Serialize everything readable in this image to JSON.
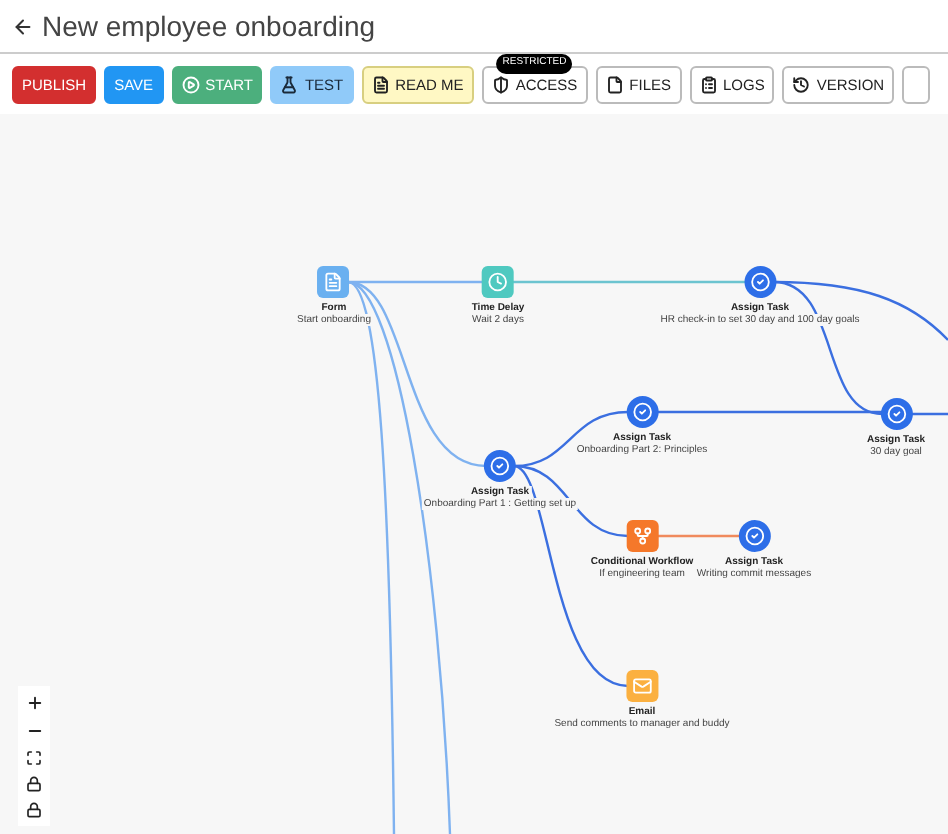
{
  "header": {
    "title": "New employee onboarding"
  },
  "toolbar": [
    {
      "kind": "publish",
      "label": "PUBLISH"
    },
    {
      "kind": "save",
      "label": "SAVE"
    },
    {
      "kind": "start",
      "label": "START"
    },
    {
      "kind": "test",
      "label": "TEST"
    },
    {
      "kind": "readme",
      "label": "READ ME"
    },
    {
      "kind": "access",
      "label": "ACCESS",
      "badge": "RESTRICTED"
    },
    {
      "kind": "files",
      "label": "FILES"
    },
    {
      "kind": "logs",
      "label": "LOGS"
    },
    {
      "kind": "version",
      "label": "VERSION"
    }
  ],
  "nodes": [
    {
      "kind": "form",
      "title": "Form",
      "subtitle": "Start onboarding"
    },
    {
      "kind": "delay",
      "title": "Time Delay",
      "subtitle": "Wait 2 days"
    },
    {
      "kind": "task",
      "title": "Assign Task",
      "subtitle": "HR check-in to set 30 day and 100 day goals"
    },
    {
      "kind": "task",
      "title": "Assign Task",
      "subtitle": "Onboarding Part 2: Principles"
    },
    {
      "kind": "task",
      "title": "Assign Task",
      "subtitle": "30 day goal"
    },
    {
      "kind": "task",
      "title": "Assign Task",
      "subtitle": "Onboarding Part 1 : Getting set up"
    },
    {
      "kind": "condition",
      "title": "Conditional Workflow",
      "subtitle": "If engineering team"
    },
    {
      "kind": "task",
      "title": "Assign Task",
      "subtitle": "Writing commit messages"
    },
    {
      "kind": "email",
      "title": "Email",
      "subtitle": "Send comments to manager and buddy"
    }
  ]
}
